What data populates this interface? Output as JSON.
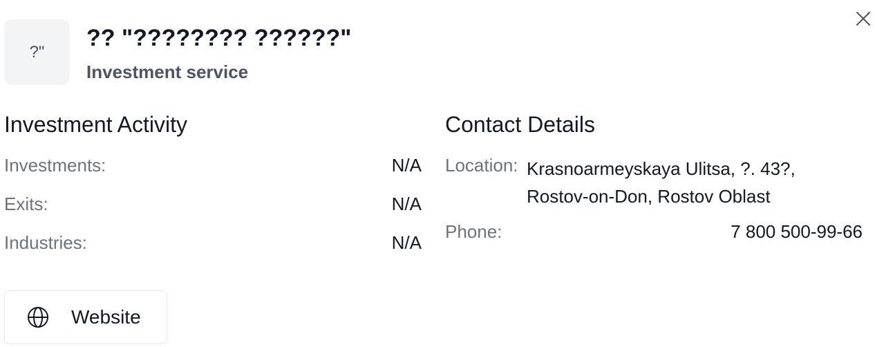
{
  "header": {
    "avatar_text": "?\"",
    "org_name": "?? \"???????? ??????\"",
    "org_type": "Investment service",
    "close_icon": "close-icon"
  },
  "investment_activity": {
    "title": "Investment Activity",
    "rows": [
      {
        "label": "Investments:",
        "value": "N/A"
      },
      {
        "label": "Exits:",
        "value": "N/A"
      },
      {
        "label": "Industries:",
        "value": "N/A"
      }
    ]
  },
  "contact_details": {
    "title": "Contact Details",
    "location_label": "Location:",
    "location_value": "Krasnoarmeyskaya Ulitsa, ?. 43?, Rostov-on-Don, Rostov Oblast",
    "phone_label": "Phone:",
    "phone_value": "7 800 500-99-66"
  },
  "actions": {
    "website_label": "Website",
    "website_icon": "globe-icon"
  }
}
